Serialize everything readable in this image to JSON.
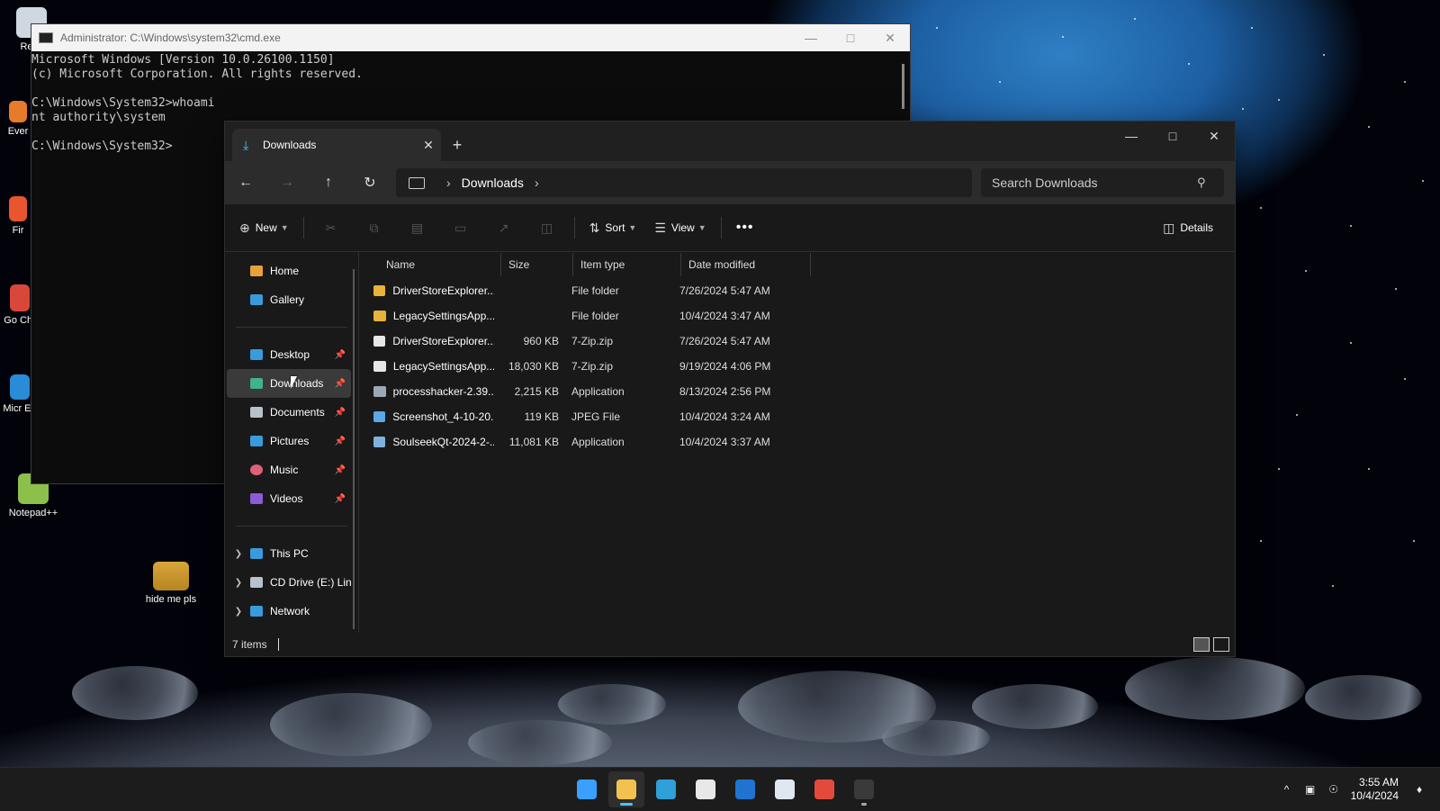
{
  "desktop": {
    "icons": [
      {
        "label": "Recy"
      },
      {
        "label": "Ever"
      },
      {
        "label": "Fir"
      },
      {
        "label": "Go Chr"
      },
      {
        "label": "Micr Ed"
      },
      {
        "label": "Notepad++"
      },
      {
        "label": "hide me pls"
      }
    ]
  },
  "cmd": {
    "title": "Administrator: C:\\Windows\\system32\\cmd.exe",
    "lines": [
      "Microsoft Windows [Version 10.0.26100.1150]",
      "(c) Microsoft Corporation. All rights reserved.",
      "",
      "C:\\Windows\\System32>whoami",
      "nt authority\\system",
      "",
      "C:\\Windows\\System32>"
    ]
  },
  "explorer": {
    "tab_label": "Downloads",
    "address": {
      "crumb": "Downloads"
    },
    "search": {
      "placeholder": "Search Downloads"
    },
    "toolbar": {
      "new_label": "New",
      "sort_label": "Sort",
      "view_label": "View",
      "more_label": "•••",
      "details_label": "Details"
    },
    "nav": {
      "top": [
        {
          "label": "Home",
          "icon": "home-icon",
          "color": "#e8a23b"
        },
        {
          "label": "Gallery",
          "icon": "gallery-icon",
          "color": "#3a9bdc"
        }
      ],
      "pinned": [
        {
          "label": "Desktop",
          "icon": "desktop-folder-icon",
          "color": "#3a9bdc"
        },
        {
          "label": "Downloads",
          "icon": "downloads-folder-icon",
          "color": "#3fb28f"
        },
        {
          "label": "Documents",
          "icon": "documents-folder-icon",
          "color": "#b7c2cc"
        },
        {
          "label": "Pictures",
          "icon": "pictures-folder-icon",
          "color": "#3a9bdc"
        },
        {
          "label": "Music",
          "icon": "music-folder-icon",
          "color": "#e0607a"
        },
        {
          "label": "Videos",
          "icon": "videos-folder-icon",
          "color": "#8a5cd6"
        }
      ],
      "bottom": [
        {
          "label": "This PC",
          "icon": "this-pc-icon",
          "color": "#3a9bdc"
        },
        {
          "label": "CD Drive (E:) Lin",
          "icon": "cd-drive-icon",
          "color": "#b7c2cc"
        },
        {
          "label": "Network",
          "icon": "network-icon",
          "color": "#3a9bdc"
        }
      ]
    },
    "columns": {
      "name": "Name",
      "size": "Size",
      "type": "Item type",
      "date": "Date modified"
    },
    "files": [
      {
        "name": "DriverStoreExplorer....",
        "size": "",
        "type": "File folder",
        "date": "7/26/2024 5:47 AM",
        "icon": "folder-icon",
        "color": "#e8b23b"
      },
      {
        "name": "LegacySettingsApp...",
        "size": "",
        "type": "File folder",
        "date": "10/4/2024 3:47 AM",
        "icon": "folder-icon",
        "color": "#e8b23b"
      },
      {
        "name": "DriverStoreExplorer....",
        "size": "960 KB",
        "type": "7-Zip.zip",
        "date": "7/26/2024 5:47 AM",
        "icon": "zip-file-icon",
        "color": "#e6e6e6"
      },
      {
        "name": "LegacySettingsApp...",
        "size": "18,030 KB",
        "type": "7-Zip.zip",
        "date": "9/19/2024 4:06 PM",
        "icon": "zip-file-icon",
        "color": "#e6e6e6"
      },
      {
        "name": "processhacker-2.39...",
        "size": "2,215 KB",
        "type": "Application",
        "date": "8/13/2024 2:56 PM",
        "icon": "app-icon",
        "color": "#9aa8b8"
      },
      {
        "name": "Screenshot_4-10-20...",
        "size": "119 KB",
        "type": "JPEG File",
        "date": "10/4/2024 3:24 AM",
        "icon": "image-file-icon",
        "color": "#5aa9e6"
      },
      {
        "name": "SoulseekQt-2024-2-...",
        "size": "11,081 KB",
        "type": "Application",
        "date": "10/4/2024 3:37 AM",
        "icon": "installer-icon",
        "color": "#7fb2e0"
      }
    ],
    "status": {
      "count": "7 items"
    }
  },
  "taskbar": {
    "apps": [
      {
        "name": "start-button",
        "color": "#3aa0ff"
      },
      {
        "name": "file-explorer-app",
        "color": "#f2c14e"
      },
      {
        "name": "edge-app",
        "color": "#2fa0d8"
      },
      {
        "name": "store-app",
        "color": "#e8e8e8"
      },
      {
        "name": "outlook-app",
        "color": "#1f74d1"
      },
      {
        "name": "notepad-app",
        "color": "#dfe7f0"
      },
      {
        "name": "chrome-app",
        "color": "#e24b3b"
      },
      {
        "name": "terminal-app",
        "color": "#3a3a3a"
      }
    ],
    "time": "3:55 AM",
    "date": "10/4/2024"
  }
}
